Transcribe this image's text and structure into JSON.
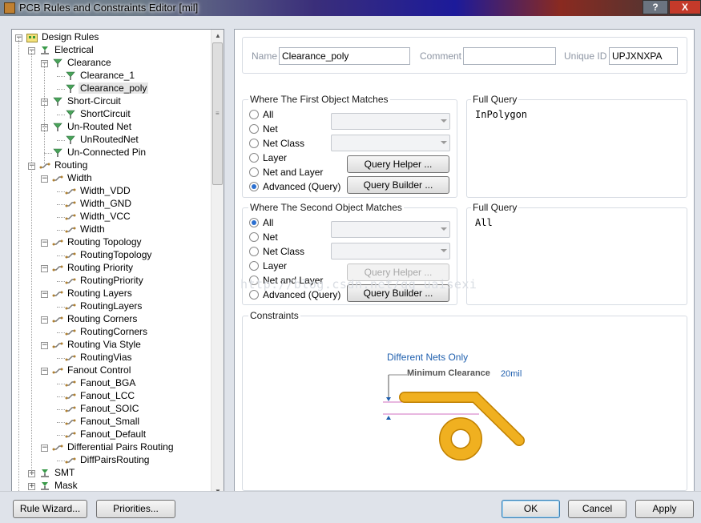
{
  "window": {
    "title": "PCB Rules and Constraints Editor [mil]",
    "help_label": "?",
    "close_label": "X"
  },
  "tree": {
    "nodes": [
      {
        "label": "Design Rules",
        "level": 0,
        "expander": "−",
        "icon": "design-rules-folder-icon"
      },
      {
        "label": "Electrical",
        "level": 1,
        "expander": "−",
        "icon": "electrical-rule-icon"
      },
      {
        "label": "Clearance",
        "level": 2,
        "expander": "−",
        "icon": "clearance-rule-icon"
      },
      {
        "label": "Clearance_1",
        "level": 3,
        "expander": "",
        "icon": "rule-icon"
      },
      {
        "label": "Clearance_poly",
        "level": 3,
        "expander": "",
        "icon": "rule-icon",
        "selected": true
      },
      {
        "label": "Short-Circuit",
        "level": 2,
        "expander": "−",
        "icon": "short-circuit-rule-icon"
      },
      {
        "label": "ShortCircuit",
        "level": 3,
        "expander": "",
        "icon": "rule-icon"
      },
      {
        "label": "Un-Routed Net",
        "level": 2,
        "expander": "−",
        "icon": "unrouted-net-rule-icon"
      },
      {
        "label": "UnRoutedNet",
        "level": 3,
        "expander": "",
        "icon": "rule-icon"
      },
      {
        "label": "Un-Connected Pin",
        "level": 2,
        "expander": "",
        "icon": "unconnected-pin-rule-icon"
      },
      {
        "label": "Routing",
        "level": 1,
        "expander": "−",
        "icon": "routing-rule-icon"
      },
      {
        "label": "Width",
        "level": 2,
        "expander": "−",
        "icon": "width-rule-icon"
      },
      {
        "label": "Width_VDD",
        "level": 3,
        "expander": "",
        "icon": "route-rule-icon"
      },
      {
        "label": "Width_GND",
        "level": 3,
        "expander": "",
        "icon": "route-rule-icon"
      },
      {
        "label": "Width_VCC",
        "level": 3,
        "expander": "",
        "icon": "route-rule-icon"
      },
      {
        "label": "Width",
        "level": 3,
        "expander": "",
        "icon": "route-rule-icon"
      },
      {
        "label": "Routing Topology",
        "level": 2,
        "expander": "−",
        "icon": "routing-topology-rule-icon"
      },
      {
        "label": "RoutingTopology",
        "level": 3,
        "expander": "",
        "icon": "route-rule-icon"
      },
      {
        "label": "Routing Priority",
        "level": 2,
        "expander": "−",
        "icon": "routing-priority-rule-icon"
      },
      {
        "label": "RoutingPriority",
        "level": 3,
        "expander": "",
        "icon": "route-rule-icon"
      },
      {
        "label": "Routing Layers",
        "level": 2,
        "expander": "−",
        "icon": "routing-layers-rule-icon"
      },
      {
        "label": "RoutingLayers",
        "level": 3,
        "expander": "",
        "icon": "route-rule-icon"
      },
      {
        "label": "Routing Corners",
        "level": 2,
        "expander": "−",
        "icon": "routing-corners-rule-icon"
      },
      {
        "label": "RoutingCorners",
        "level": 3,
        "expander": "",
        "icon": "route-rule-icon"
      },
      {
        "label": "Routing Via Style",
        "level": 2,
        "expander": "−",
        "icon": "routing-via-style-rule-icon"
      },
      {
        "label": "RoutingVias",
        "level": 3,
        "expander": "",
        "icon": "route-rule-icon"
      },
      {
        "label": "Fanout Control",
        "level": 2,
        "expander": "−",
        "icon": "fanout-control-rule-icon"
      },
      {
        "label": "Fanout_BGA",
        "level": 3,
        "expander": "",
        "icon": "route-rule-icon"
      },
      {
        "label": "Fanout_LCC",
        "level": 3,
        "expander": "",
        "icon": "route-rule-icon"
      },
      {
        "label": "Fanout_SOIC",
        "level": 3,
        "expander": "",
        "icon": "route-rule-icon"
      },
      {
        "label": "Fanout_Small",
        "level": 3,
        "expander": "",
        "icon": "route-rule-icon"
      },
      {
        "label": "Fanout_Default",
        "level": 3,
        "expander": "",
        "icon": "route-rule-icon"
      },
      {
        "label": "Differential Pairs Routing",
        "level": 2,
        "expander": "−",
        "icon": "diff-pairs-rule-icon"
      },
      {
        "label": "DiffPairsRouting",
        "level": 3,
        "expander": "",
        "icon": "route-rule-icon"
      },
      {
        "label": "SMT",
        "level": 1,
        "expander": "+",
        "icon": "smt-rule-icon"
      },
      {
        "label": "Mask",
        "level": 1,
        "expander": "+",
        "icon": "mask-rule-icon"
      }
    ]
  },
  "rule": {
    "name_label": "Name",
    "name_value": "Clearance_poly",
    "comment_label": "Comment",
    "comment_value": "",
    "uid_label": "Unique ID",
    "uid_value": "UPJXNXPA"
  },
  "first_match": {
    "title": "Where The First Object Matches",
    "options": [
      "All",
      "Net",
      "Net Class",
      "Layer",
      "Net and Layer",
      "Advanced (Query)"
    ],
    "selected": "Advanced (Query)",
    "query_helper": "Query Helper ...",
    "query_builder": "Query Builder ...",
    "full_query_label": "Full Query",
    "full_query": "InPolygon"
  },
  "second_match": {
    "title": "Where The Second Object Matches",
    "options": [
      "All",
      "Net",
      "Net Class",
      "Layer",
      "Net and Layer",
      "Advanced (Query)"
    ],
    "selected": "All",
    "query_helper": "Query Helper ...",
    "query_builder": "Query Builder ...",
    "full_query_label": "Full Query",
    "full_query": "All"
  },
  "constraints": {
    "title": "Constraints",
    "nets_label": "Different Nets Only",
    "min_clearance_label": "Minimum Clearance",
    "min_clearance_value": "20mil"
  },
  "watermark": "http://blog.csdn.net/qq_uaisexi",
  "buttons": {
    "rule_wizard": "Rule Wizard...",
    "priorities": "Priorities...",
    "ok": "OK",
    "cancel": "Cancel",
    "apply": "Apply"
  },
  "colors": {
    "accent": "#2a6fd0",
    "trace": "#f0b020",
    "trace_outline": "#c08000",
    "link_text": "#1f5fae"
  }
}
